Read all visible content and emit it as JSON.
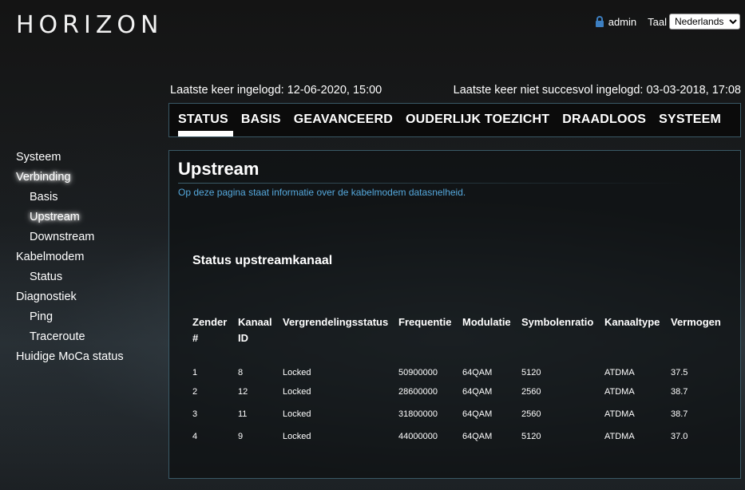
{
  "header": {
    "logo_text": "HORIZON",
    "user": "admin",
    "language_label": "Taal",
    "language_selected": "Nederlands"
  },
  "login_info": {
    "last_login": "Laatste keer ingelogd: 12-06-2020, 15:00",
    "last_failed_login": "Laatste keer niet succesvol ingelogd: 03-03-2018, 17:08"
  },
  "top_nav": {
    "tabs": [
      {
        "label": "STATUS",
        "active": true
      },
      {
        "label": "BASIS"
      },
      {
        "label": "GEAVANCEERD"
      },
      {
        "label": "OUDERLIJK TOEZICHT"
      },
      {
        "label": "DRAADLOOS"
      },
      {
        "label": "SYSTEEM"
      }
    ]
  },
  "sidebar": {
    "items": [
      {
        "label": "Systeem"
      },
      {
        "label": "Verbinding",
        "active": true
      },
      {
        "label": "Basis"
      },
      {
        "label": "Upstream",
        "active": true
      },
      {
        "label": "Downstream"
      },
      {
        "label": "Kabelmodem"
      },
      {
        "label": "Status"
      },
      {
        "label": "Diagnostiek"
      },
      {
        "label": "Ping"
      },
      {
        "label": "Traceroute"
      },
      {
        "label": "Huidige MoCa status"
      }
    ]
  },
  "main": {
    "title": "Upstream",
    "description": "Op deze pagina staat informatie over de kabelmodem datasnelheid.",
    "section_title": "Status upstreamkanaal",
    "table": {
      "headers": [
        "Zender #",
        "Kanaal ID",
        "Vergrendelingsstatus",
        "Frequentie",
        "Modulatie",
        "Symbolenratio",
        "Kanaaltype",
        "Vermogen"
      ],
      "rows": [
        [
          "1",
          "8",
          "Locked",
          "50900000",
          "64QAM",
          "5120",
          "ATDMA",
          "37.5"
        ],
        [
          "2",
          "12",
          "Locked",
          "28600000",
          "64QAM",
          "2560",
          "ATDMA",
          "38.7"
        ],
        [
          "3",
          "11",
          "Locked",
          "31800000",
          "64QAM",
          "2560",
          "ATDMA",
          "38.7"
        ],
        [
          "4",
          "9",
          "Locked",
          "44000000",
          "64QAM",
          "5120",
          "ATDMA",
          "37.0"
        ]
      ]
    }
  },
  "colors": {
    "accent_link": "#55a8dc",
    "border": "#3a5966"
  }
}
